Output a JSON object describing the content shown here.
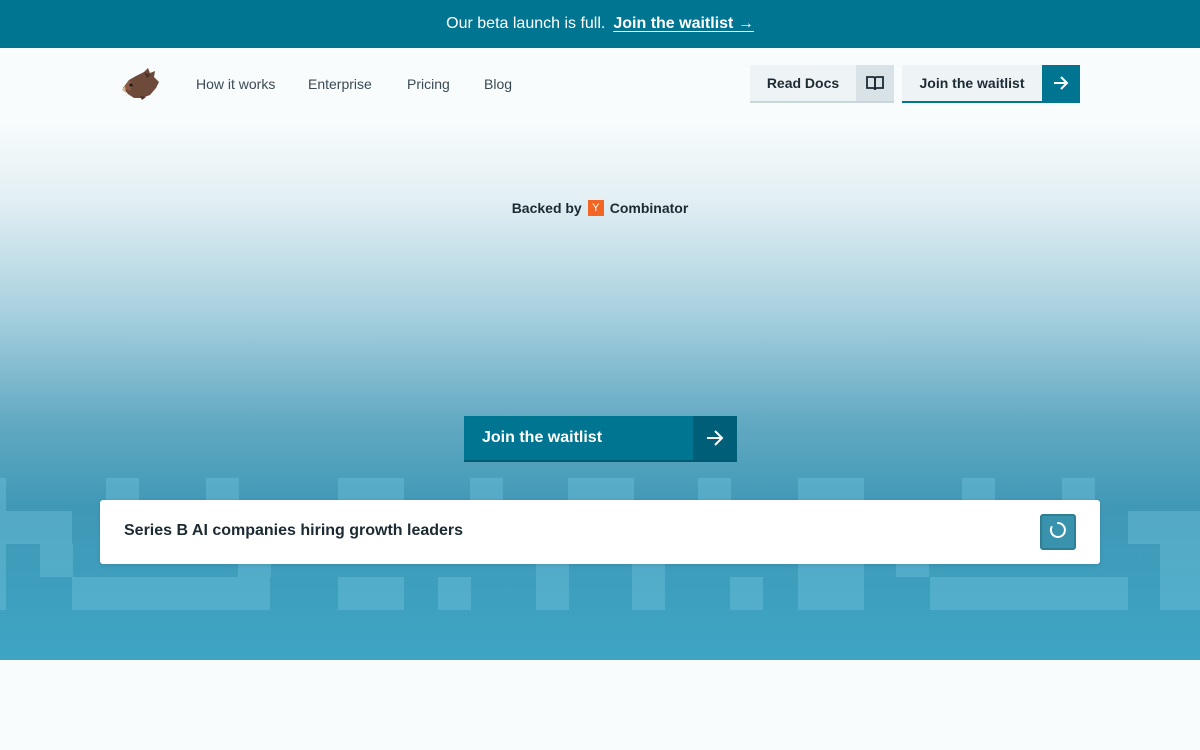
{
  "banner": {
    "text": "Our beta launch is full.",
    "link": "Join the waitlist →"
  },
  "nav": {
    "logo_icon": "boar-logo-icon",
    "links": [
      {
        "label": "How it works"
      },
      {
        "label": "Enterprise"
      },
      {
        "label": "Pricing"
      },
      {
        "label": "Blog"
      }
    ],
    "docs_button": {
      "label": "Read Docs",
      "icon": "book-icon"
    },
    "waitlist_button": {
      "label": "Join the waitlist",
      "icon": "arrow-right-icon"
    }
  },
  "hero": {
    "backed_prefix": "Backed by",
    "yc_badge": "Y",
    "backed_suffix": "Combinator",
    "cta": {
      "label": "Join the waitlist",
      "icon": "arrow-right-icon"
    }
  },
  "search": {
    "value": "Series B AI companies hiring growth leaders",
    "button_icon": "loading-spinner-icon"
  },
  "colors": {
    "accent": "#007591",
    "accent_dark": "#005f78",
    "yc_orange": "#f26522",
    "text": "#1c2a33",
    "background": "#f8fcfd"
  }
}
